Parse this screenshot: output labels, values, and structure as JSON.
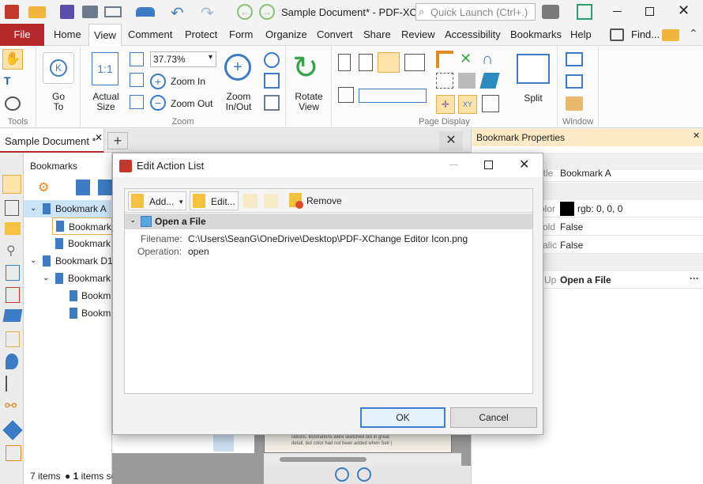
{
  "app": {
    "title": "Sample Document* - PDF-XCh...",
    "quick_launch_placeholder": "Quick Launch (Ctrl+.)"
  },
  "ribbon_tabs": {
    "file": "File",
    "items": [
      "Home",
      "View",
      "Comment",
      "Protect",
      "Form",
      "Organize",
      "Convert",
      "Share",
      "Review",
      "Accessibility",
      "Bookmarks",
      "Help"
    ],
    "find": "Find..."
  },
  "ribbon": {
    "tools_label": "Tools",
    "go_to": "Go\nTo",
    "actual_size": "Actual\nSize",
    "zoom_value": "37.73%",
    "zoom_in": "Zoom In",
    "zoom_out": "Zoom Out",
    "zoom_inout": "Zoom\nIn/Out",
    "zoom_label": "Zoom",
    "rotate_view": "Rotate\nView",
    "page_display_label": "Page Display",
    "split": "Split",
    "window_label": "Window"
  },
  "doc_tab": {
    "name": "Sample Document *"
  },
  "bookmarks_panel": {
    "title": "Bookmarks",
    "items": [
      "Bookmark A",
      "Bookmark",
      "Bookmark",
      "Bookmark D1",
      "Bookmark",
      "Bookm",
      "Bookm"
    ],
    "status_count": "7 items",
    "status_selected_num": "1",
    "status_selected": "items selected"
  },
  "bookmark_properties": {
    "title": "Bookmark Properties",
    "title_label": "itle",
    "title_value": "Bookmark A",
    "color_label": "olor",
    "color_value": "rgb: 0, 0, 0",
    "bold_label": "old",
    "bold_value": "False",
    "italic_label": "alic",
    "italic_value": "False",
    "action_label": "Up",
    "action_value": "Open a File",
    "more": "···"
  },
  "dialog": {
    "title": "Edit Action List",
    "add": "Add...",
    "edit": "Edit...",
    "remove": "Remove",
    "section": "Open a File",
    "filename_label": "Filename:",
    "filename_value": "C:\\Users\\SeanG\\OneDrive\\Desktop\\PDF-XChange Editor Icon.png",
    "operation_label": "Operation:",
    "operation_value": "open",
    "ok": "OK",
    "cancel": "Cancel"
  },
  "doc_snippet": {
    "line1": "rations. Illustrations were sketched out in great",
    "line2": "detail, but color had not been added when Seti |"
  },
  "colors": {
    "accent": "#b5282c",
    "selection": "#cce4f7",
    "dialog_primary": "#3c7fd6",
    "panel_header": "#fdebc8"
  }
}
